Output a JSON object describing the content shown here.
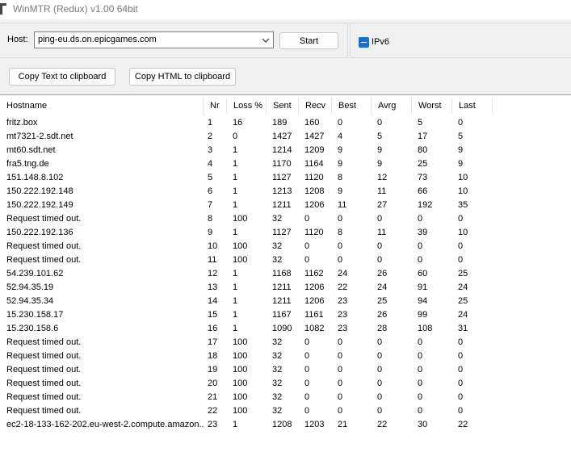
{
  "window": {
    "title": "WinMTR (Redux) v1.00 64bit"
  },
  "host": {
    "label": "Host:",
    "value": "ping-eu.ds.on.epicgames.com"
  },
  "buttons": {
    "start": "Start",
    "copy_text": "Copy Text to clipboard",
    "copy_html": "Copy HTML to clipboard"
  },
  "ipv6": {
    "label": "IPv6",
    "checked": "indeterminate"
  },
  "table": {
    "headers": [
      "Hostname",
      "Nr",
      "Loss %",
      "Sent",
      "Recv",
      "Best",
      "Avrg",
      "Worst",
      "Last"
    ],
    "rows": [
      [
        "fritz.box",
        "1",
        "16",
        "189",
        "160",
        "0",
        "0",
        "5",
        "0"
      ],
      [
        "mt7321-2.sdt.net",
        "2",
        "0",
        "1427",
        "1427",
        "4",
        "5",
        "17",
        "5"
      ],
      [
        "mt60.sdt.net",
        "3",
        "1",
        "1214",
        "1209",
        "9",
        "9",
        "80",
        "9"
      ],
      [
        "fra5.tng.de",
        "4",
        "1",
        "1170",
        "1164",
        "9",
        "9",
        "25",
        "9"
      ],
      [
        "151.148.8.102",
        "5",
        "1",
        "1127",
        "1120",
        "8",
        "12",
        "73",
        "10"
      ],
      [
        "150.222.192.148",
        "6",
        "1",
        "1213",
        "1208",
        "9",
        "11",
        "66",
        "10"
      ],
      [
        "150.222.192.149",
        "7",
        "1",
        "1211",
        "1206",
        "11",
        "27",
        "192",
        "35"
      ],
      [
        "Request timed out.",
        "8",
        "100",
        "32",
        "0",
        "0",
        "0",
        "0",
        "0"
      ],
      [
        "150.222.192.136",
        "9",
        "1",
        "1127",
        "1120",
        "8",
        "11",
        "39",
        "10"
      ],
      [
        "Request timed out.",
        "10",
        "100",
        "32",
        "0",
        "0",
        "0",
        "0",
        "0"
      ],
      [
        "Request timed out.",
        "11",
        "100",
        "32",
        "0",
        "0",
        "0",
        "0",
        "0"
      ],
      [
        "54.239.101.62",
        "12",
        "1",
        "1168",
        "1162",
        "24",
        "26",
        "60",
        "25"
      ],
      [
        "52.94.35.19",
        "13",
        "1",
        "1211",
        "1206",
        "22",
        "24",
        "91",
        "24"
      ],
      [
        "52.94.35.34",
        "14",
        "1",
        "1211",
        "1206",
        "23",
        "25",
        "94",
        "25"
      ],
      [
        "15.230.158.17",
        "15",
        "1",
        "1167",
        "1161",
        "23",
        "26",
        "99",
        "24"
      ],
      [
        "15.230.158.6",
        "16",
        "1",
        "1090",
        "1082",
        "23",
        "28",
        "108",
        "31"
      ],
      [
        "Request timed out.",
        "17",
        "100",
        "32",
        "0",
        "0",
        "0",
        "0",
        "0"
      ],
      [
        "Request timed out.",
        "18",
        "100",
        "32",
        "0",
        "0",
        "0",
        "0",
        "0"
      ],
      [
        "Request timed out.",
        "19",
        "100",
        "32",
        "0",
        "0",
        "0",
        "0",
        "0"
      ],
      [
        "Request timed out.",
        "20",
        "100",
        "32",
        "0",
        "0",
        "0",
        "0",
        "0"
      ],
      [
        "Request timed out.",
        "21",
        "100",
        "32",
        "0",
        "0",
        "0",
        "0",
        "0"
      ],
      [
        "Request timed out.",
        "22",
        "100",
        "32",
        "0",
        "0",
        "0",
        "0",
        "0"
      ],
      [
        "ec2-18-133-162-202.eu-west-2.compute.amazon...",
        "23",
        "1",
        "1208",
        "1203",
        "21",
        "22",
        "30",
        "22"
      ]
    ]
  }
}
